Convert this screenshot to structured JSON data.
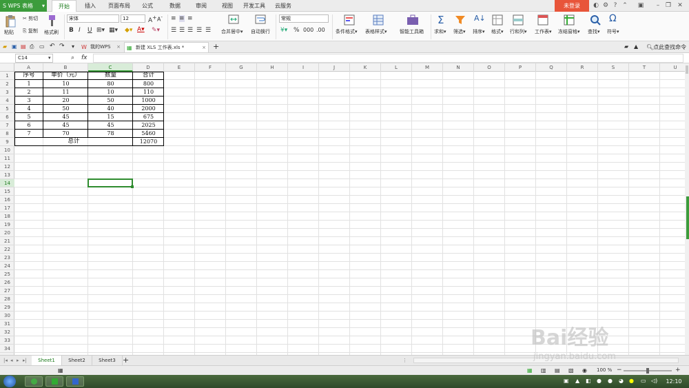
{
  "app": {
    "name": "WPS 表格",
    "login_label": "未登录"
  },
  "menu": {
    "tabs": [
      "开始",
      "插入",
      "页面布局",
      "公式",
      "数据",
      "审阅",
      "视图",
      "开发工具",
      "云服务"
    ],
    "active": 0
  },
  "ribbon": {
    "paste": "粘贴",
    "cut": "剪切",
    "copy": "复制",
    "format_painter": "格式刷",
    "font_name": "宋体",
    "font_size": "12",
    "bold": "B",
    "italic": "I",
    "underline": "U",
    "merge_center": "合并居中",
    "wrap_text": "自动换行",
    "number_format": "常规",
    "percent": "%",
    "conditional_format": "条件格式",
    "table_style": "表格样式",
    "smart_tools": "智能工具箱",
    "sum": "求和",
    "filter": "筛选",
    "sort": "排序",
    "format": "格式",
    "row_col": "行和列",
    "worksheet": "工作表",
    "freeze": "冻结窗格",
    "find": "查找",
    "symbol": "符号"
  },
  "quickbar": {
    "tabs": [
      {
        "label": "我的WPS"
      },
      {
        "label": "新建 XLS 工作表.xls *"
      }
    ],
    "search_cmd": "点此查找命令"
  },
  "formula_bar": {
    "name_box": "C14",
    "fx": "fx",
    "value": ""
  },
  "columns": [
    "A",
    "B",
    "C",
    "D",
    "E",
    "F",
    "G",
    "H",
    "I",
    "J",
    "K",
    "L",
    "M",
    "N",
    "O",
    "P",
    "Q",
    "R",
    "S",
    "T",
    "U"
  ],
  "selected_col": "C",
  "selected_row": 14,
  "row_count": 34,
  "table": {
    "headers": [
      "序号",
      "单价（元）",
      "数量",
      "合计"
    ],
    "rows": [
      [
        "1",
        "10",
        "80",
        "800"
      ],
      [
        "2",
        "11",
        "10",
        "110"
      ],
      [
        "3",
        "20",
        "50",
        "1000"
      ],
      [
        "4",
        "50",
        "40",
        "2000"
      ],
      [
        "5",
        "45",
        "15",
        "675"
      ],
      [
        "6",
        "45",
        "45",
        "2025"
      ],
      [
        "7",
        "70",
        "78",
        "5460"
      ]
    ],
    "total_label": "总计",
    "total_value": "12070"
  },
  "sheets": [
    "Sheet1",
    "Sheet2",
    "Sheet3"
  ],
  "active_sheet": 0,
  "status": {
    "zoom": "100 %"
  },
  "taskbar": {
    "clock": "12:10"
  },
  "watermark": {
    "text": "Bai经验",
    "sub": "jingyan.baidu.com"
  }
}
